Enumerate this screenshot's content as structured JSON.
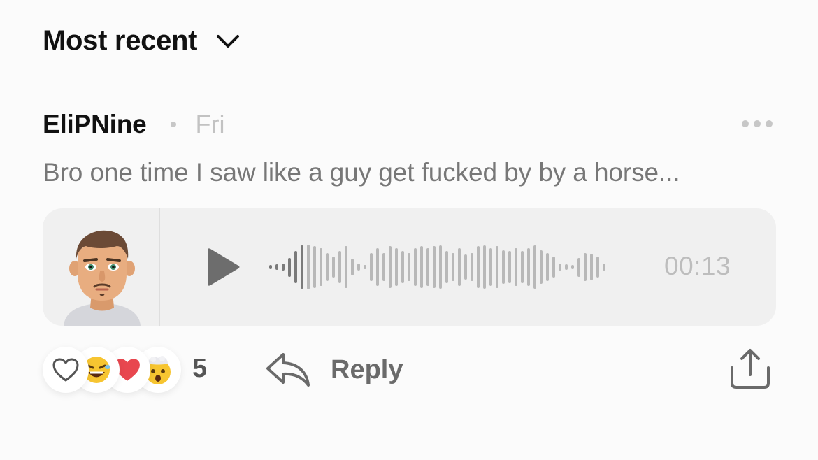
{
  "sort": {
    "label": "Most recent"
  },
  "comment": {
    "author": "EliPNine",
    "time": "Fri",
    "text": "Bro one time I saw like a guy get fucked by by a horse..."
  },
  "voice_message": {
    "duration": "00:13",
    "played_fraction": 0.12
  },
  "reactions": {
    "icons": [
      "heart-outline-icon",
      "laughing-emoji-icon",
      "red-heart-icon",
      "mind-blown-emoji-icon"
    ],
    "count": "5"
  },
  "reply": {
    "label": "Reply"
  },
  "colors": {
    "background": "#fbfbfb",
    "card": "#f0f0f0",
    "muted_text": "#777777",
    "heart_red": "#e8474f",
    "emoji_yellow": "#f7c531"
  }
}
